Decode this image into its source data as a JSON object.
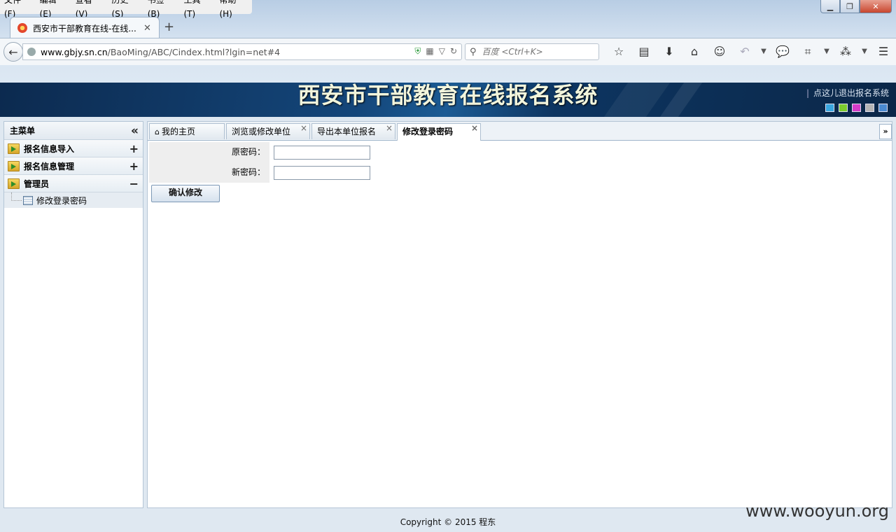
{
  "browser": {
    "menu": [
      "文件(F)",
      "编辑(E)",
      "查看(V)",
      "历史(S)",
      "书签(B)",
      "工具(T)",
      "帮助(H)"
    ],
    "tab_title": "西安市干部教育在线-在线...",
    "url_host": "www.gbjy.sn.cn",
    "url_path": "/BaoMing/ABC/Cindex.html?lgin=net#4",
    "search_placeholder": "百度 <Ctrl+K>"
  },
  "header": {
    "title": "西安市干部教育在线报名系统",
    "logout": "点这儿退出报名系统",
    "theme_colors": [
      "#3aa7e0",
      "#7ccc2e",
      "#d43bc8",
      "#b5b5b5",
      "#4a8ad0"
    ]
  },
  "sidebar": {
    "title": "主菜单",
    "groups": [
      {
        "label": "报名信息导入",
        "toggle": "+"
      },
      {
        "label": "报名信息管理",
        "toggle": "+"
      },
      {
        "label": "管理员",
        "toggle": "−"
      }
    ],
    "leaf": "修改登录密码"
  },
  "tabs": {
    "home": "我的主页",
    "browse": "浏览或修改单位",
    "export": "导出本单位报名",
    "change_pw": "修改登录密码"
  },
  "form": {
    "old_pw_label": "原密码：",
    "new_pw_label": "新密码：",
    "old_pw_value": "",
    "new_pw_value": "",
    "submit": "确认修改"
  },
  "footer": "Copyright © 2015 程东",
  "watermark": "www.wooyun.org"
}
